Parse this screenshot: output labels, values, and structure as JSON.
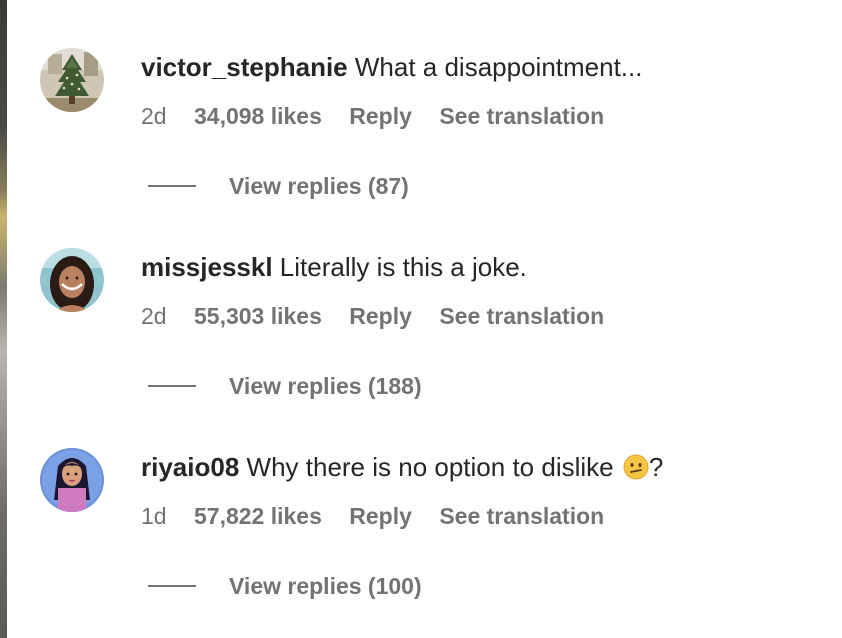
{
  "comments": [
    {
      "username": "victor_stephanie",
      "text": "What a disappointment...",
      "emoji": "",
      "age": "2d",
      "likes": "34,098 likes",
      "reply_label": "Reply",
      "translate_label": "See translation",
      "view_replies": "View replies (87)",
      "avatar_icon": "christmas-tree-photo"
    },
    {
      "username": "missjesskl",
      "text": "Literally is this a joke.",
      "emoji": "",
      "age": "2d",
      "likes": "55,303 likes",
      "reply_label": "Reply",
      "translate_label": "See translation",
      "view_replies": "View replies (188)",
      "avatar_icon": "smiling-woman-photo"
    },
    {
      "username": "riyaio08",
      "text": "Why there is no option to dislike",
      "emoji": "confused-face",
      "emoji_suffix": "?",
      "age": "1d",
      "likes": "57,822 likes",
      "reply_label": "Reply",
      "translate_label": "See translation",
      "view_replies": "View replies (100)",
      "avatar_icon": "cartoon-girl-illustration"
    }
  ],
  "colors": {
    "primary_text": "#262626",
    "secondary_text": "#737373",
    "background": "#ffffff"
  }
}
